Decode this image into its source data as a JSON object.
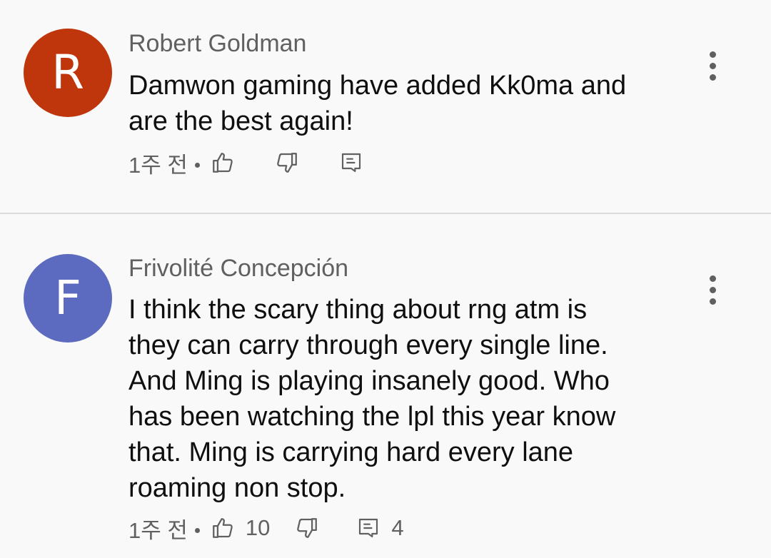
{
  "comments": [
    {
      "author": "Robert Goldman",
      "avatar_letter": "R",
      "avatar_color": "#c0360c",
      "text": "Damwon gaming have added Kk0ma and\nare the best again!",
      "time": "1주 전",
      "like_count": "",
      "reply_count": ""
    },
    {
      "author": "Frivolité Concepción",
      "avatar_letter": "F",
      "avatar_color": "#5c6bc0",
      "text": "I think the scary thing about rng atm is\nthey can carry through every single line.\nAnd Ming is playing insanely good. Who\nhas been watching the lpl this year know\nthat. Ming is carrying hard every lane\nroaming non stop.",
      "time": "1주 전",
      "like_count": "10",
      "reply_count": "4"
    }
  ],
  "icons": {
    "like": "thumbs-up-icon",
    "dislike": "thumbs-down-icon",
    "reply": "reply-comment-icon",
    "more": "more-vertical-icon"
  },
  "colors": {
    "background": "#f9f9f9",
    "secondary_text": "#606060",
    "divider": "#dcdcdc"
  }
}
